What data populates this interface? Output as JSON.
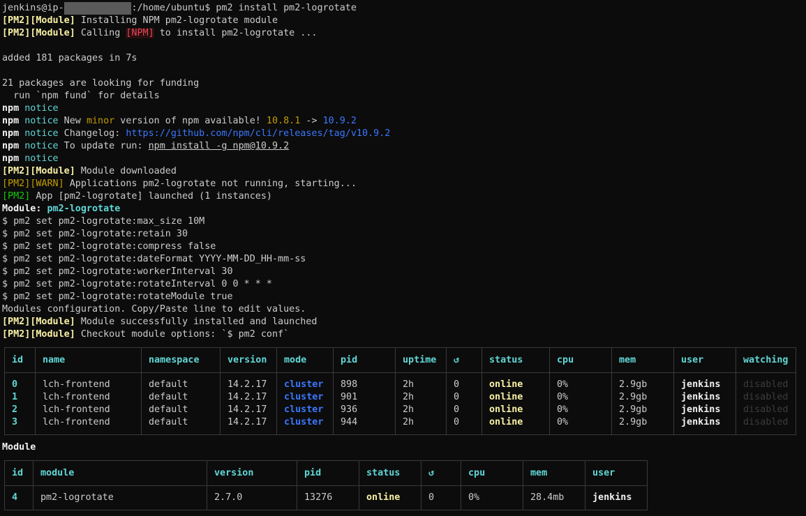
{
  "terminal": {
    "prompt_user": "jenkins@ip-",
    "prompt_path": ":/home/ubuntu$ pm2 install pm2-logrotate",
    "pm2_tag": "[PM2]",
    "module_tag": "[Module]",
    "npm_tag": "[NPM]",
    "warn_tag": "[WARN]",
    "l2_text": " Installing NPM pm2-logrotate module",
    "l3_text_a": " Calling ",
    "l3_text_b": " to install pm2-logrotate ...",
    "l5": "added 181 packages in 7s",
    "l7": "21 packages are looking for funding",
    "l8": "  run `npm fund` for details",
    "npm": "npm",
    "notice": "notice",
    "l10_a": " New ",
    "l10_minor": "minor",
    "l10_b": " version of npm available! ",
    "l10_old": "10.8.1",
    "l10_arrow": " -> ",
    "l10_new": "10.9.2",
    "l11_a": " Changelog: ",
    "l11_url": "https://github.com/npm/cli/releases/tag/v10.9.2",
    "l12_a": " To update run: ",
    "l12_cmd": "npm install -g npm@10.9.2",
    "l14_text": " Module downloaded",
    "l15_text": " Applications pm2-logrotate not running, starting...",
    "l16_text": " App [pm2-logrotate] launched (1 instances)",
    "l17_label": "Module: ",
    "l17_name": "pm2-logrotate",
    "set_cmds": [
      "$ pm2 set pm2-logrotate:max_size 10M",
      "$ pm2 set pm2-logrotate:retain 30",
      "$ pm2 set pm2-logrotate:compress false",
      "$ pm2 set pm2-logrotate:dateFormat YYYY-MM-DD_HH-mm-ss",
      "$ pm2 set pm2-logrotate:workerInterval 30",
      "$ pm2 set pm2-logrotate:rotateInterval 0 0 * * *",
      "$ pm2 set pm2-logrotate:rotateModule true"
    ],
    "l25": "Modules configuration. Copy/Paste line to edit values.",
    "l26_text": " Module successfully installed and launched",
    "l27_text": " Checkout module options: `$ pm2 conf`",
    "module_heading": "Module"
  },
  "apps_table": {
    "headers": [
      "id",
      "name",
      "namespace",
      "version",
      "mode",
      "pid",
      "uptime",
      "↺",
      "status",
      "cpu",
      "mem",
      "user",
      "watching"
    ],
    "rows": [
      [
        "0",
        "lch-frontend",
        "default",
        "14.2.17",
        "cluster",
        "898",
        "2h",
        "0",
        "online",
        "0%",
        "2.9gb",
        "jenkins",
        "disabled"
      ],
      [
        "1",
        "lch-frontend",
        "default",
        "14.2.17",
        "cluster",
        "901",
        "2h",
        "0",
        "online",
        "0%",
        "2.9gb",
        "jenkins",
        "disabled"
      ],
      [
        "2",
        "lch-frontend",
        "default",
        "14.2.17",
        "cluster",
        "936",
        "2h",
        "0",
        "online",
        "0%",
        "2.9gb",
        "jenkins",
        "disabled"
      ],
      [
        "3",
        "lch-frontend",
        "default",
        "14.2.17",
        "cluster",
        "944",
        "2h",
        "0",
        "online",
        "0%",
        "2.9gb",
        "jenkins",
        "disabled"
      ]
    ]
  },
  "module_table": {
    "headers": [
      "id",
      "module",
      "version",
      "pid",
      "status",
      "↺",
      "cpu",
      "mem",
      "user"
    ],
    "rows": [
      [
        "4",
        "pm2-logrotate",
        "2.7.0",
        "13276",
        "online",
        "0",
        "0%",
        "28.4mb",
        "jenkins"
      ]
    ]
  },
  "colors": {
    "background": "#0c0c0c",
    "text": "#cccccc",
    "yellow_bold": "#f9f1a5",
    "cyan": "#61d6d6",
    "blue": "#3b78ff",
    "red": "#e74856",
    "green": "#16c60c"
  }
}
